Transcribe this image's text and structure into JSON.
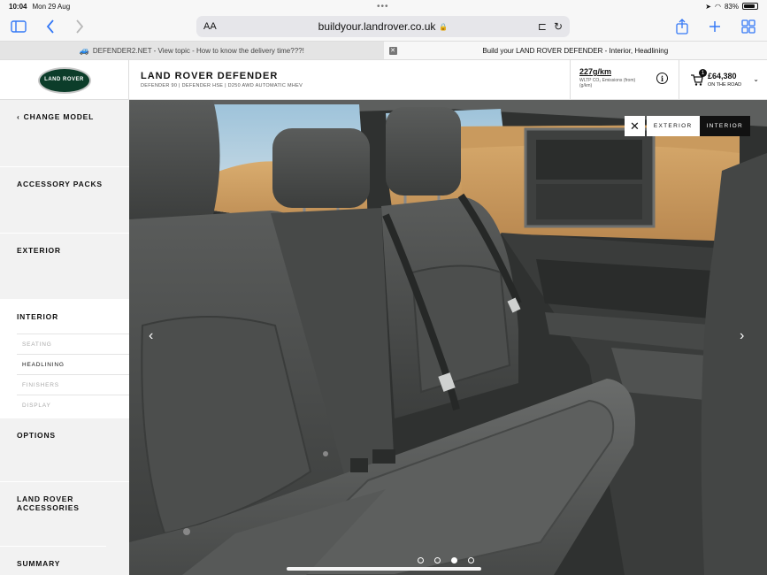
{
  "status": {
    "time": "10:04",
    "date": "Mon 29 Aug",
    "battery": "83%",
    "battery_level": 0.83
  },
  "browser": {
    "url": "buildyour.landrover.co.uk",
    "aa_label": "AA",
    "tabs": [
      {
        "title": "DEFENDER2.NET - View topic - How to know the delivery time???!"
      },
      {
        "title": "Build your LAND ROVER DEFENDER - Interior, Headlining"
      }
    ]
  },
  "header": {
    "logo_text": "LAND ROVER",
    "model": "LAND ROVER DEFENDER",
    "spec": "DEFENDER 90 | DEFENDER HSE | D250 AWD AUTOMATIC MHEV",
    "emissions_value": "227g/km",
    "emissions_label": "WLTP CO₂ Emissions (from) (g/km)",
    "cart_count": "1",
    "price": "£64,380",
    "price_label": "ON THE ROAD"
  },
  "sidebar": {
    "change_model": "CHANGE MODEL",
    "items": [
      {
        "label": "ACCESSORY PACKS"
      },
      {
        "label": "EXTERIOR"
      },
      {
        "label": "INTERIOR"
      },
      {
        "label": "OPTIONS"
      },
      {
        "label": "LAND ROVER ACCESSORIES"
      },
      {
        "label": "SUMMARY"
      }
    ],
    "interior_sub": [
      {
        "label": "SEATING"
      },
      {
        "label": "HEADLINING"
      },
      {
        "label": "FINISHERS"
      },
      {
        "label": "DISPLAY"
      }
    ]
  },
  "viewer": {
    "exterior_label": "EXTERIOR",
    "interior_label": "INTERIOR",
    "slides_total": 4,
    "slide_active": 3
  }
}
